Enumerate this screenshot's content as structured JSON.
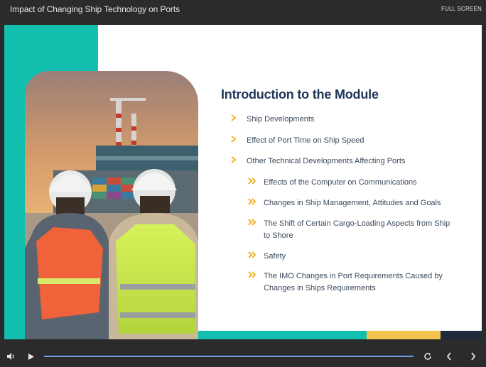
{
  "window": {
    "course_title": "Impact of Changing Ship Technology on Ports",
    "fullscreen_label": "FULL SCREEN"
  },
  "slide": {
    "title": "Introduction to the Module",
    "items": [
      {
        "text": "Ship Developments"
      },
      {
        "text": "Effect of Port Time on Ship Speed"
      },
      {
        "text": "Other Technical Developments Affecting Ports"
      },
      {
        "text": "Effects of the Computer on Communications"
      },
      {
        "text": "Changes in Ship Management, Attitudes and Goals"
      },
      {
        "text": "The Shift of Certain Cargo-Loading Aspects from Ship to Shore"
      },
      {
        "text": "Safety"
      },
      {
        "text": "The IMO Changes in Port Requirements Caused by Changes in Ships Requirements"
      }
    ]
  },
  "player": {
    "icons": [
      "volume-icon",
      "play-icon",
      "replay-icon",
      "previous-icon",
      "next-icon"
    ],
    "progress_fraction": 0.0
  },
  "colors": {
    "accent_teal": "#12bfae",
    "accent_yellow": "#f1c44f",
    "navy": "#1d2b3b",
    "title_navy": "#1f3556",
    "bullet": "#f0b429",
    "progress_blue": "#6fa0e6"
  }
}
